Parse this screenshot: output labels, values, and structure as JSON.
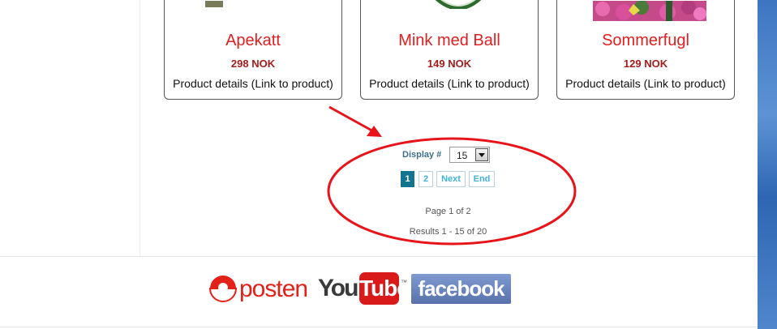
{
  "products": [
    {
      "name": "Apekatt",
      "price": "298 NOK",
      "details": "Product details (Link to product)"
    },
    {
      "name": "Mink med Ball",
      "price": "149 NOK",
      "details": "Product details (Link to product)"
    },
    {
      "name": "Sommerfugl",
      "price": "129 NOK",
      "details": "Product details (Link to product)"
    }
  ],
  "pagination": {
    "display_label": "Display #",
    "display_value": "15",
    "pages": [
      "1",
      "2"
    ],
    "next": "Next",
    "end": "End",
    "page_info": "Page 1 of 2",
    "results_info": "Results 1 - 15 of 20"
  },
  "footer": {
    "posten": "posten",
    "youtube_you": "You",
    "youtube_tube": "Tube",
    "youtube_tm": "™",
    "facebook": "facebook"
  },
  "colors": {
    "product_name": "#e02020",
    "price": "#a41c1c",
    "pager_active": "#13748f",
    "annotation": "#e8141a"
  }
}
